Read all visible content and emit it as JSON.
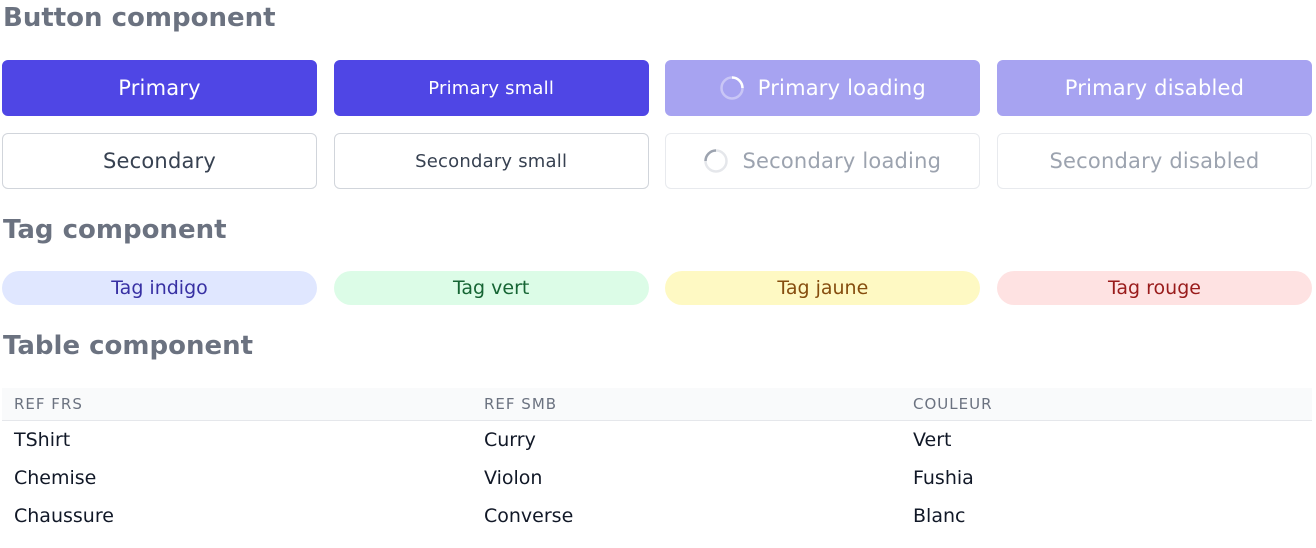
{
  "headings": {
    "buttons": "Button component",
    "tags": "Tag component",
    "table": "Table component"
  },
  "buttons": {
    "primary": "Primary",
    "primary_small": "Primary small",
    "primary_loading": "Primary loading",
    "primary_disabled": "Primary disabled",
    "secondary": "Secondary",
    "secondary_small": "Secondary small",
    "secondary_loading": "Secondary loading",
    "secondary_disabled": "Secondary disabled"
  },
  "tags": {
    "indigo": "Tag indigo",
    "vert": "Tag vert",
    "jaune": "Tag jaune",
    "rouge": "Tag rouge"
  },
  "table": {
    "columns": [
      "REF FRS",
      "REF SMB",
      "COULEUR"
    ],
    "rows": [
      [
        "TShirt",
        "Curry",
        "Vert"
      ],
      [
        "Chemise",
        "Violon",
        "Fushia"
      ],
      [
        "Chaussure",
        "Converse",
        "Blanc"
      ]
    ]
  },
  "colors": {
    "primary": "#4f46e5",
    "primary_dim": "#a7a3f1",
    "heading": "#6b7280"
  },
  "icons": {
    "loading": "spinner-icon"
  }
}
